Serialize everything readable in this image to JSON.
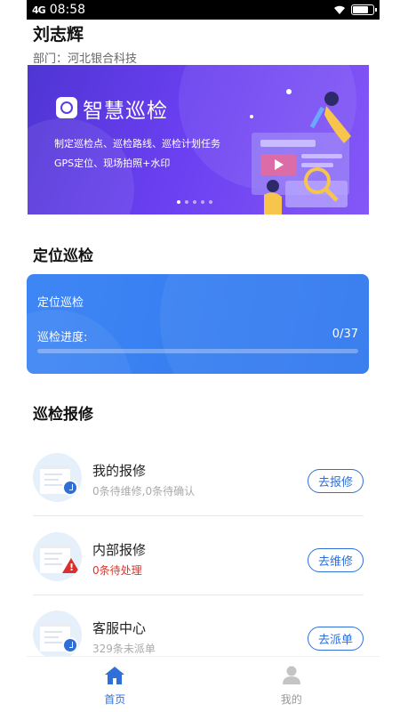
{
  "status_bar": {
    "signal": "4G",
    "time": "08:58"
  },
  "user": {
    "name": "刘志辉",
    "department": "部门：河北银合科技"
  },
  "banner": {
    "title": "智慧巡检",
    "line1": "制定巡检点、巡检路线、巡检计划任务",
    "line2": "GPS定位、现场拍照+水印",
    "page_count": 5,
    "active_page": 1
  },
  "location_section": {
    "heading": "定位巡检",
    "card_title": "定位巡检",
    "progress_label": "巡检进度:",
    "progress_value": "0/37",
    "progress_fraction": 0
  },
  "repair_section": {
    "heading": "巡检报修",
    "items": [
      {
        "name": "我的报修",
        "subtitle": "0条待维修,0条待确认",
        "button": "去报修",
        "icon": "repair-doc-icon"
      },
      {
        "name": "内部报修",
        "subtitle": "0条待处理",
        "button": "去维修",
        "icon": "warning-doc-icon"
      },
      {
        "name": "客服中心",
        "subtitle": "329条未派单",
        "button": "去派单",
        "icon": "service-doc-icon"
      }
    ]
  },
  "tabbar": {
    "items": [
      {
        "label": "首页",
        "icon": "home-icon",
        "active": true
      },
      {
        "label": "我的",
        "icon": "person-icon",
        "active": false
      }
    ]
  },
  "colors": {
    "primary": "#2f6fd8",
    "card_blue": "#3f86f5",
    "warning_red": "#e0322b"
  }
}
